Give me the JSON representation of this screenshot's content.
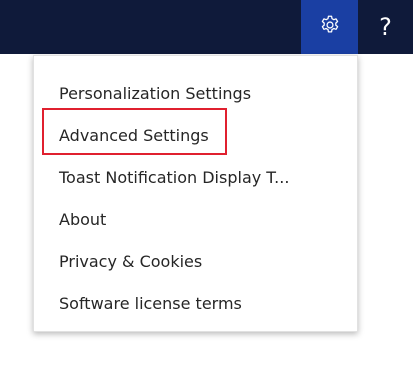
{
  "topbar": {
    "settings_icon": "gear-icon",
    "help_icon": "question-mark-icon",
    "help_label": "?"
  },
  "menu": {
    "items": [
      {
        "label": "Personalization Settings"
      },
      {
        "label": "Advanced Settings"
      },
      {
        "label": "Toast Notification Display T..."
      },
      {
        "label": "About"
      },
      {
        "label": "Privacy & Cookies"
      },
      {
        "label": "Software license terms"
      }
    ],
    "highlighted_item": "Advanced Settings",
    "highlight_color": "#e0202f"
  },
  "colors": {
    "topbar_bg": "#0f1a3a",
    "settings_active_bg": "#1a3fa3"
  }
}
